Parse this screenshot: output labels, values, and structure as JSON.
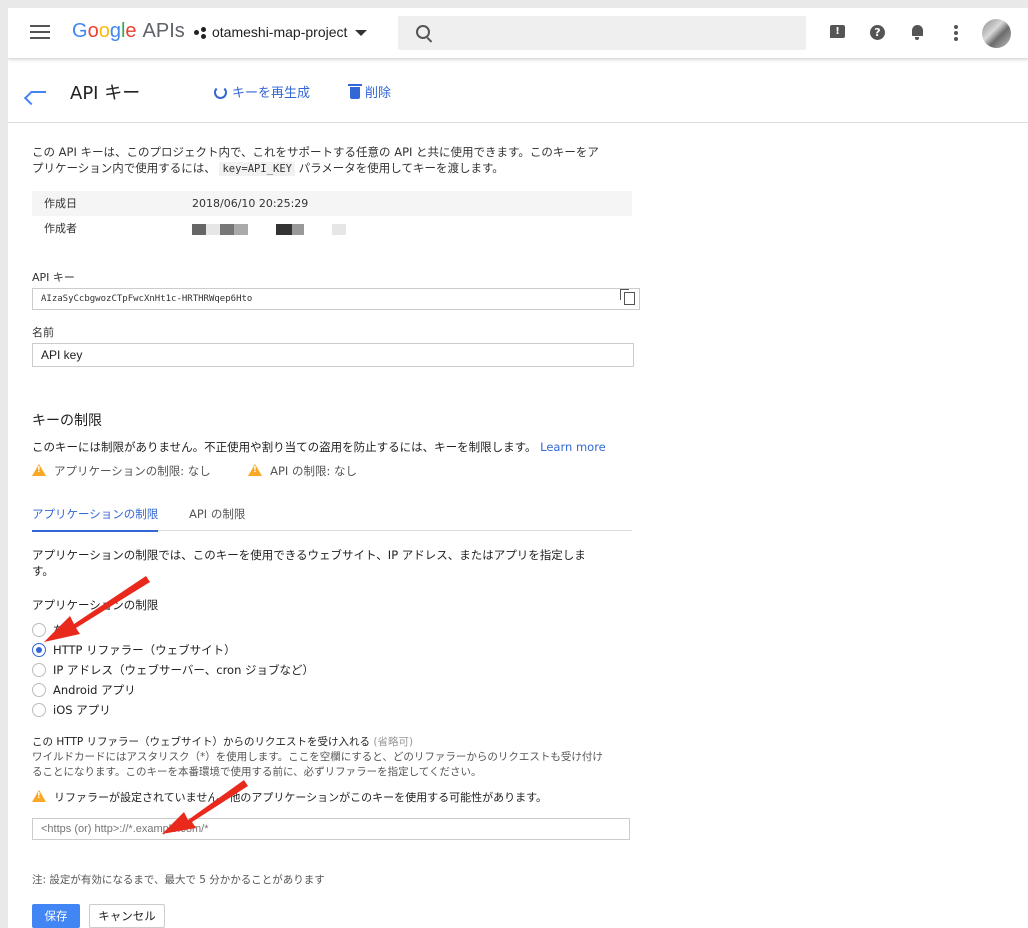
{
  "topbar": {
    "logo_google": [
      "G",
      "o",
      "o",
      "g",
      "l",
      "e"
    ],
    "logo_apis": "APIs",
    "project_name": "otameshi-map-project",
    "search_placeholder": ""
  },
  "header": {
    "title": "API キー",
    "regenerate_label": "キーを再生成",
    "delete_label": "削除"
  },
  "intro": {
    "line1": "この API キーは、このプロジェクト内で、これをサポートする任意の API と共に使用できます。このキーをア",
    "line2_a": "プリケーション内で使用するには、",
    "line2_code": "key=API_KEY",
    "line2_b": "パラメータを使用してキーを渡します。"
  },
  "meta": {
    "created_label": "作成日",
    "created_value": "2018/06/10 20:25:29",
    "creator_label": "作成者"
  },
  "api_key": {
    "label": "API キー",
    "value": "AIzaSyCcbgwozCTpFwcXnHt1c-HRTHRWqep6Hto"
  },
  "name": {
    "label": "名前",
    "value": "API key"
  },
  "restrictions": {
    "heading": "キーの制限",
    "desc": "このキーには制限がありません。不正使用や割り当ての盗用を防止するには、キーを制限します。",
    "learn_more": "Learn more",
    "app_restriction": "アプリケーションの制限: なし",
    "api_restriction": "API の制限: なし"
  },
  "tabs": {
    "app": "アプリケーションの制限",
    "api": "API の制限"
  },
  "app_section": {
    "desc_line1": "アプリケーションの制限では、このキーを使用できるウェブサイト、IP アドレス、またはアプリを指定しま",
    "desc_line2": "す。",
    "heading": "アプリケーションの制限",
    "options": [
      "なし",
      "HTTP リファラー（ウェブサイト）",
      "IP アドレス（ウェブサーバー、cron ジョブなど）",
      "Android アプリ",
      "iOS アプリ"
    ],
    "selected_index": 1
  },
  "referrer": {
    "title": "この HTTP リファラー（ウェブサイト）からのリクエストを受け入れる",
    "optional": "(省略可)",
    "help_line1": "ワイルドカードにはアスタリスク（*）を使用します。ここを空欄にすると、どのリファラーからのリクエストも受け付け",
    "help_line2": "ることになります。このキーを本番環境で使用する前に、必ずリファラーを指定してください。",
    "warning": "リファラーが設定されていません。他のアプリケーションがこのキーを使用する可能性があります。",
    "placeholder": "<https (or) http>://*.example.com/*"
  },
  "footer": {
    "note": "注: 設定が有効になるまで、最大で 5 分かかることがあります",
    "save": "保存",
    "cancel": "キャンセル"
  },
  "colors": {
    "accent": "#3367d6",
    "primary_button": "#4285f4",
    "warning": "#f9a825",
    "annotation_arrow": "#e8291c"
  }
}
